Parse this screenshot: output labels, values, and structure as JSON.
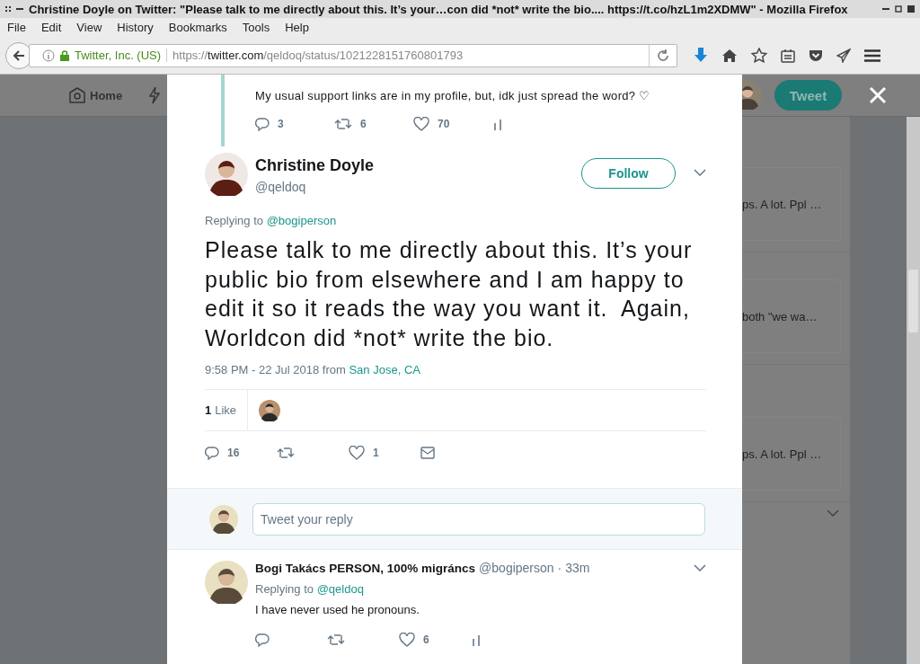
{
  "window": {
    "title": "Christine Doyle on Twitter: \"Please talk to me directly about this. It’s your…con did *not* write the bio.... https://t.co/hzL1m2XDMW\" - Mozilla Firefox"
  },
  "menu": [
    "File",
    "Edit",
    "View",
    "History",
    "Bookmarks",
    "Tools",
    "Help"
  ],
  "address_bar": {
    "identity": "Twitter, Inc. (US)",
    "url_scheme": "https://",
    "url_host": "twitter.com",
    "url_path": "/qeldoq/status/1021228151760801793"
  },
  "page": {
    "nav": {
      "home": "Home",
      "tweet_button": "Tweet"
    },
    "side_cards": [
      {
        "text": "ps. A lot. Ppl …"
      },
      {
        "text": "both \"we wa…"
      },
      {
        "text": "ps. A lot. Ppl …"
      }
    ]
  },
  "modal": {
    "previous_tweet": {
      "text": "My usual support links are in my profile, but, idk just spread the word? ♡",
      "actions": [
        {
          "kind": "reply",
          "count": "3"
        },
        {
          "kind": "retweet",
          "count": "6"
        },
        {
          "kind": "like",
          "count": "70"
        },
        {
          "kind": "analytics"
        }
      ]
    },
    "tweet": {
      "name": "Christine Doyle",
      "handle": "@qeldoq",
      "follow": "Follow",
      "replying_label": "Replying to",
      "replying_to": "@bogiperson",
      "text": "Please talk to me directly about this. It’s your public bio from elsewhere and I am happy to edit it so it reads the way you want it.  Again, Worldcon did *not* write the bio.",
      "time": "9:58 PM - 22 Jul 2018",
      "from": "from",
      "place": "San Jose, CA",
      "likes_count": "1",
      "likes_label": "Like",
      "actions": [
        {
          "kind": "reply",
          "count": "16"
        },
        {
          "kind": "retweet"
        },
        {
          "kind": "like",
          "count": "1"
        },
        {
          "kind": "message"
        }
      ]
    },
    "reply_box": {
      "placeholder": "Tweet your reply"
    },
    "replies": [
      {
        "name": "Bogi Takács PERSON, 100% migráncs",
        "handle": "@bogiperson",
        "separator": "·",
        "time": "33m",
        "replying_label": "Replying to",
        "replying_to": "@qeldoq",
        "text": "I have never used he pronouns.",
        "actions": [
          {
            "kind": "reply"
          },
          {
            "kind": "retweet"
          },
          {
            "kind": "like",
            "count": "6"
          },
          {
            "kind": "analytics"
          }
        ]
      }
    ]
  }
}
